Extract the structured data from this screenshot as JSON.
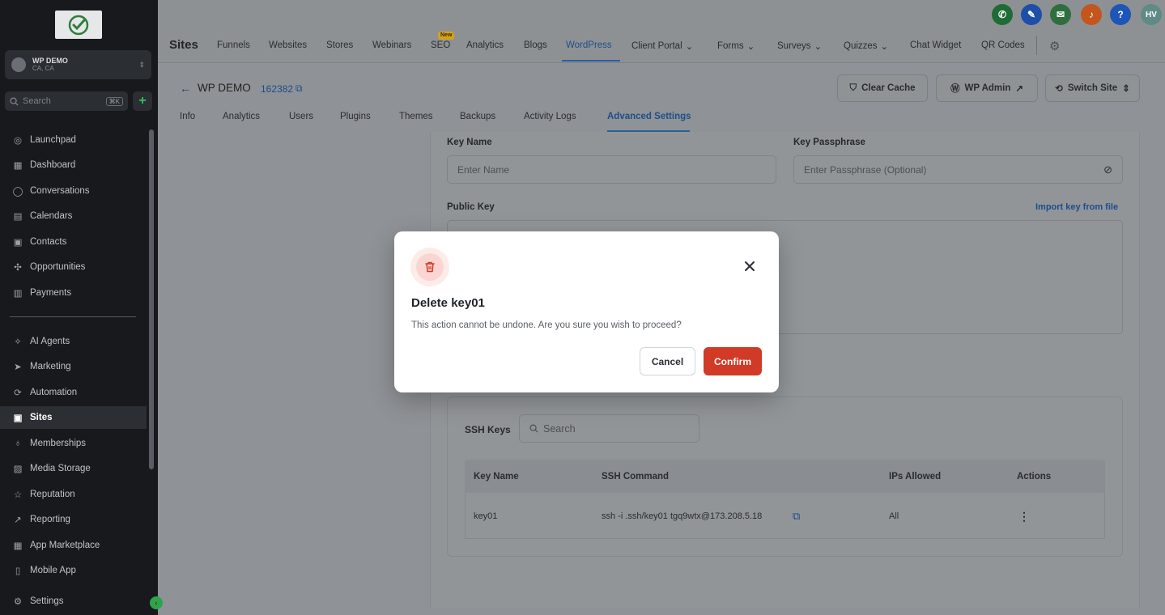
{
  "sidebar": {
    "account_name": "WP DEMO",
    "account_location": "CA, CA",
    "search_placeholder": "Search",
    "search_shortcut": "⌘K",
    "plus_label": "+",
    "items": [
      {
        "label": "Launchpad",
        "icon": "rocket-icon"
      },
      {
        "label": "Dashboard",
        "icon": "dashboard-icon"
      },
      {
        "label": "Conversations",
        "icon": "chat-icon"
      },
      {
        "label": "Calendars",
        "icon": "calendar-icon"
      },
      {
        "label": "Contacts",
        "icon": "contacts-icon"
      },
      {
        "label": "Opportunities",
        "icon": "opportunities-icon"
      },
      {
        "label": "Payments",
        "icon": "payments-icon"
      },
      {
        "label": "AI Agents",
        "icon": "ai-icon"
      },
      {
        "label": "Marketing",
        "icon": "send-icon"
      },
      {
        "label": "Automation",
        "icon": "automation-icon"
      },
      {
        "label": "Sites",
        "icon": "sites-icon",
        "active": true
      },
      {
        "label": "Memberships",
        "icon": "membership-icon"
      },
      {
        "label": "Media Storage",
        "icon": "media-icon"
      },
      {
        "label": "Reputation",
        "icon": "star-icon"
      },
      {
        "label": "Reporting",
        "icon": "reporting-icon"
      },
      {
        "label": "App Marketplace",
        "icon": "apps-icon"
      },
      {
        "label": "Mobile App",
        "icon": "mobile-icon"
      },
      {
        "label": "Settings",
        "icon": "gear-icon"
      }
    ]
  },
  "topbar": {
    "title": "Sites",
    "tabs": [
      "Funnels",
      "Websites",
      "Stores",
      "Webinars",
      "SEO",
      "Analytics",
      "Blogs",
      "WordPress",
      "Client Portal",
      "Forms",
      "Surveys",
      "Quizzes",
      "Chat Widget",
      "QR Codes"
    ],
    "active_tab": "WordPress",
    "new_badge": "New",
    "avatar_initials": "HV",
    "help_label": "?"
  },
  "site": {
    "name": "WP DEMO",
    "id": "162382",
    "buttons": {
      "clear_cache": "Clear Cache",
      "wp_admin": "WP Admin",
      "switch_site": "Switch Site"
    },
    "tabs": [
      "Info",
      "Analytics",
      "Users",
      "Plugins",
      "Themes",
      "Backups",
      "Activity Logs",
      "Advanced Settings"
    ],
    "active_tab": "Advanced Settings"
  },
  "form": {
    "key_name_label": "Key Name",
    "key_name_placeholder": "Enter Name",
    "passphrase_label": "Key Passphrase",
    "passphrase_placeholder": "Enter Passphrase (Optional)",
    "public_key_label": "Public Key",
    "import_link": "Import key from file"
  },
  "ssh": {
    "title": "SSH Keys",
    "search_placeholder": "Search",
    "columns": [
      "Key Name",
      "SSH Command",
      "IPs Allowed",
      "Actions"
    ],
    "rows": [
      {
        "key_name": "key01",
        "command": "ssh -i .ssh/key01 tgq9wtx@173.208.5.18",
        "ips": "All"
      }
    ]
  },
  "modal": {
    "title": "Delete key01",
    "body": "This action cannot be undone. Are you sure you wish to proceed?",
    "cancel": "Cancel",
    "confirm": "Confirm"
  },
  "colors": {
    "confirm": "#d03a26",
    "accent": "#1e4f8a",
    "sidebar_bg": "#17191d"
  }
}
